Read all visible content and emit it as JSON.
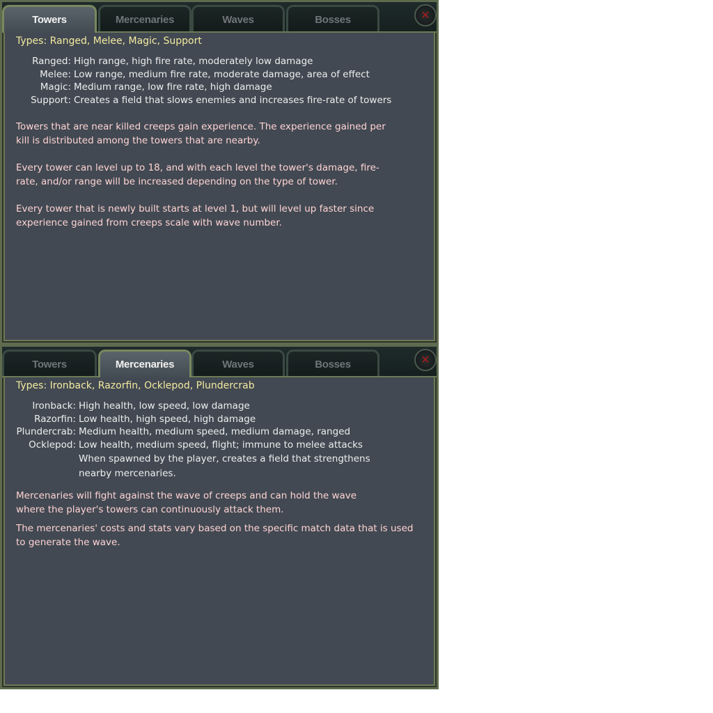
{
  "tabs": [
    "Towers",
    "Mercenaries",
    "Waves",
    "Bosses"
  ],
  "close_glyph": "✕",
  "towers_panel": {
    "active_tab": "Towers",
    "types_line": "Types: Ranged, Melee, Magic, Support",
    "definitions": [
      {
        "label": "Ranged:",
        "desc": "High range, high fire rate, moderately low damage"
      },
      {
        "label": "Melee:",
        "desc": "Low range, medium fire rate, moderate damage, area of effect"
      },
      {
        "label": "Magic:",
        "desc": "Medium range, low fire rate, high damage"
      },
      {
        "label": "Support:",
        "desc": "Creates a field that slows enemies and increases fire-rate of towers"
      }
    ],
    "notes": [
      "Towers that are near killed creeps gain experience. The experience gained per kill is distributed among the towers that are nearby.",
      "Every tower can level up to 18, and with each level the tower's damage, fire-rate, and/or range will be increased depending on the type of tower.",
      "Every tower that is newly built starts at level 1, but will level up faster since experience gained from creeps scale with wave number."
    ]
  },
  "mercenaries_panel": {
    "active_tab": "Mercenaries",
    "types_line": "Types: Ironback, Razorfin, Ocklepod, Plundercrab",
    "definitions": [
      {
        "label": "Ironback:",
        "desc": "High health, low speed, low damage"
      },
      {
        "label": "Razorfin:",
        "desc": "Low health, high speed, high damage"
      },
      {
        "label": "Plundercrab:",
        "desc": "Medium health, medium speed, medium damage, ranged"
      },
      {
        "label": "Ocklepod:",
        "desc": "Low health, medium speed, flight; immune to melee attacks"
      },
      {
        "label": "",
        "desc": "When spawned by the player, creates a field that strengthens"
      },
      {
        "label": "",
        "desc": "nearby mercenaries."
      }
    ],
    "notes": [
      "Mercenaries will fight against the wave of creeps and can hold the wave where the player's towers can continuously attack them.",
      "The mercenaries' costs and stats vary based on the specific match data that is used to generate the wave."
    ]
  }
}
